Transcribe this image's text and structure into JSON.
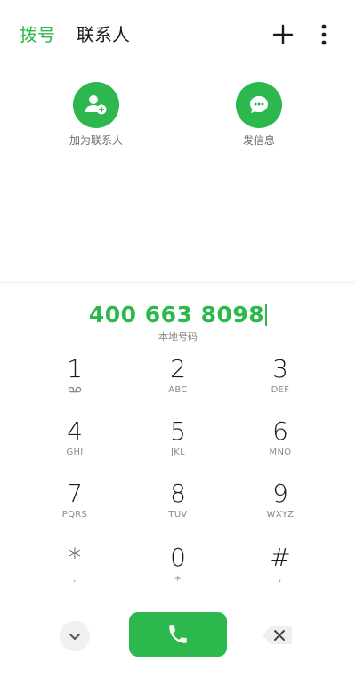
{
  "header": {
    "tab_dial": "拨号",
    "tab_contacts": "联系人",
    "plus_icon": "plus-icon",
    "menu_icon": "more-vertical-icon"
  },
  "actions": {
    "add_contact_label": "加为联系人",
    "send_message_label": "发信息"
  },
  "dialer": {
    "number": "400 663 8098",
    "location": "本地号码"
  },
  "keypad": [
    {
      "digit": "1",
      "letters": "oo"
    },
    {
      "digit": "2",
      "letters": "ABC"
    },
    {
      "digit": "3",
      "letters": "DEF"
    },
    {
      "digit": "4",
      "letters": "GHI"
    },
    {
      "digit": "5",
      "letters": "JKL"
    },
    {
      "digit": "6",
      "letters": "MNO"
    },
    {
      "digit": "7",
      "letters": "PQRS"
    },
    {
      "digit": "8",
      "letters": "TUV"
    },
    {
      "digit": "9",
      "letters": "WXYZ"
    },
    {
      "digit": "*",
      "letters": ","
    },
    {
      "digit": "0",
      "letters": "+"
    },
    {
      "digit": "#",
      "letters": ";"
    }
  ],
  "colors": {
    "accent": "#2db84d",
    "text": "#1a1a1a",
    "muted": "#8a8a8a"
  }
}
